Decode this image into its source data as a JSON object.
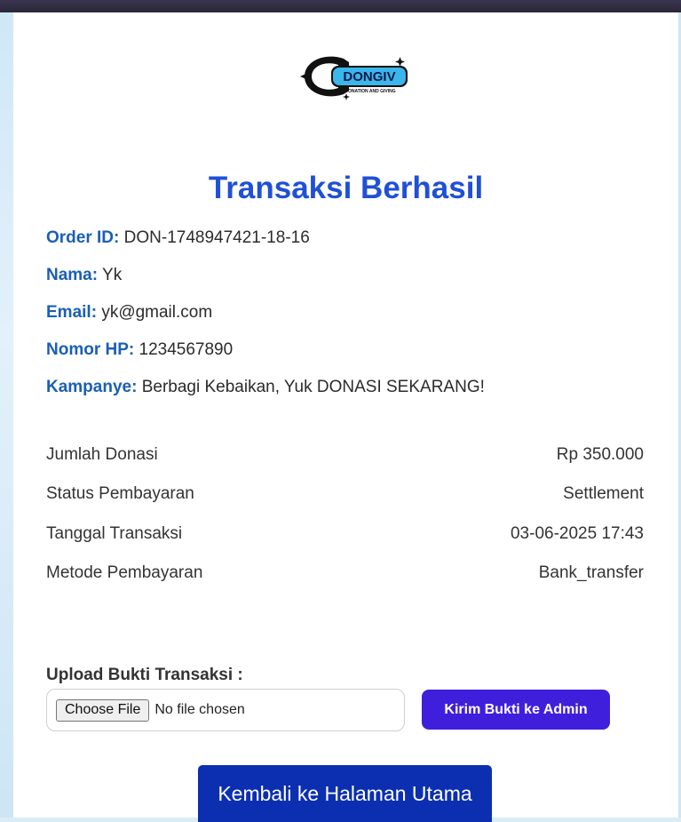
{
  "logo": {
    "name": "DONGIV",
    "tagline": "DONATION AND GIVING"
  },
  "title": "Transaksi Berhasil",
  "info": [
    {
      "label": "Order ID:",
      "value": "DON-1748947421-18-16"
    },
    {
      "label": "Nama:",
      "value": "Yk"
    },
    {
      "label": "Email:",
      "value": "yk@gmail.com"
    },
    {
      "label": "Nomor HP:",
      "value": "1234567890"
    },
    {
      "label": "Kampanye:",
      "value": "Berbagi Kebaikan, Yuk DONASI SEKARANG!"
    }
  ],
  "details": [
    {
      "label": "Jumlah Donasi",
      "value": "Rp 350.000"
    },
    {
      "label": "Status Pembayaran",
      "value": "Settlement"
    },
    {
      "label": "Tanggal Transaksi",
      "value": "03-06-2025 17:43"
    },
    {
      "label": "Metode Pembayaran",
      "value": "Bank_transfer"
    }
  ],
  "upload": {
    "label": "Upload Bukti Transaksi :",
    "choose_label": "Choose File",
    "status": "No file chosen",
    "send_label": "Kirim Bukti ke Admin"
  },
  "home_button": "Kembali ke Halaman Utama",
  "colors": {
    "title": "#1f50d6",
    "label": "#1a5fb4",
    "send": "#3f1fdc",
    "home": "#0b2fb0"
  }
}
